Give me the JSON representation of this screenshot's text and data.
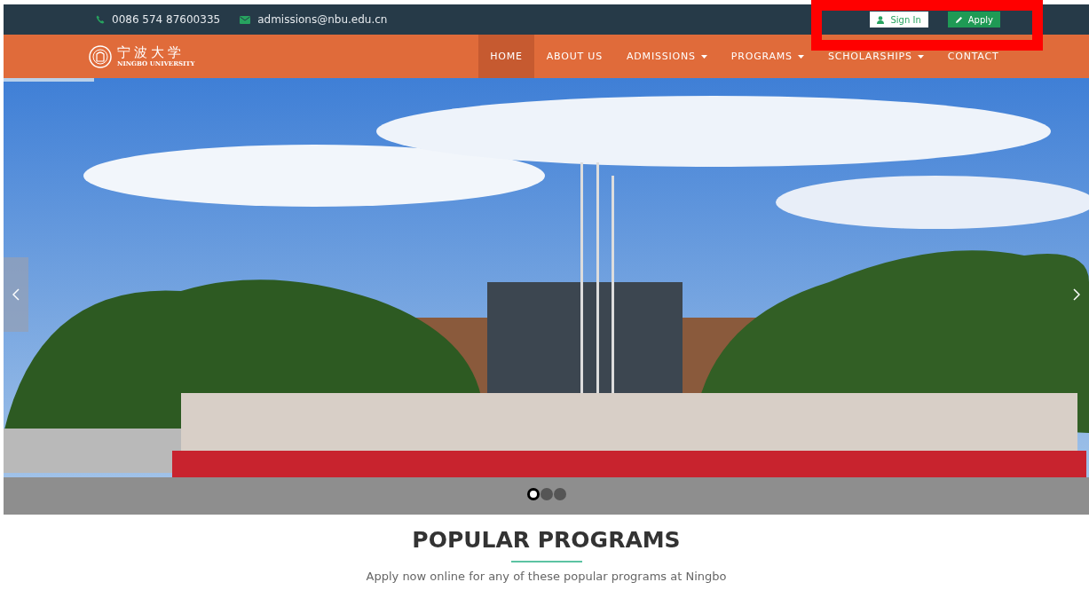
{
  "top_bar": {
    "phone": "0086 574 87600335",
    "email": "admissions@nbu.edu.cn",
    "buttons": [
      {
        "label": "Sign In",
        "kind": "outline"
      },
      {
        "label": "Apply",
        "kind": "solid"
      }
    ]
  },
  "annotation": {
    "kind": "highlight"
  },
  "logo": {
    "name": "宁波大学",
    "subtitle": "NINGBO UNIVERSITY"
  },
  "nav": [
    {
      "label": "HOME",
      "selected": true,
      "dropdown": false
    },
    {
      "label": "ABOUT US",
      "selected": false,
      "dropdown": false
    },
    {
      "label": "ADMISSIONS",
      "selected": false,
      "dropdown": true
    },
    {
      "label": "PROGRAMS",
      "selected": false,
      "dropdown": true
    },
    {
      "label": "SCHOLARSHIPS",
      "selected": false,
      "dropdown": true
    },
    {
      "label": "CONTACT",
      "selected": false,
      "dropdown": false
    }
  ],
  "slider": {
    "level": 0.083,
    "dots": [
      {
        "selected": true
      },
      {
        "selected": false
      },
      {
        "selected": false
      }
    ]
  },
  "section": {
    "title": "POPULAR PROGRAMS",
    "subtitle": "Apply now online for any of these popular programs at Ningbo"
  }
}
